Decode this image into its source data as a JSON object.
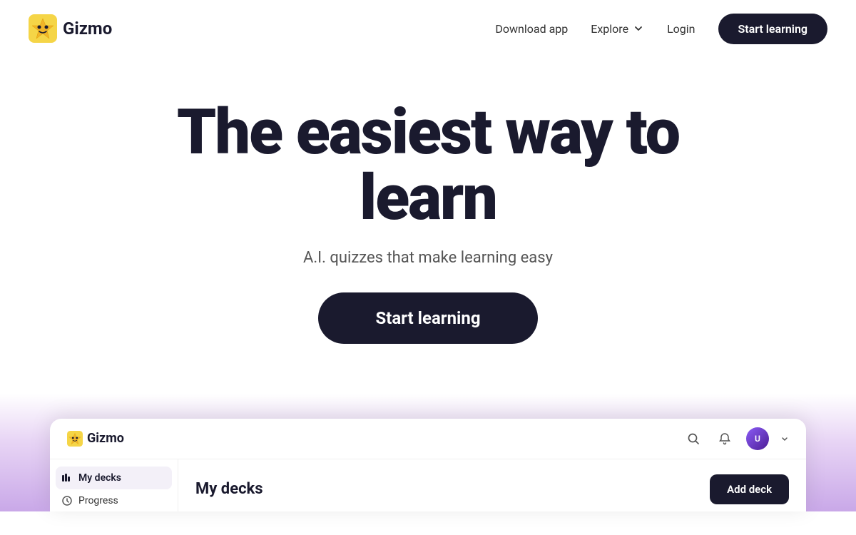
{
  "navbar": {
    "logo_text": "Gizmo",
    "nav_download": "Download app",
    "nav_explore": "Explore",
    "nav_login": "Login",
    "nav_start_learning": "Start learning"
  },
  "hero": {
    "title": "The easiest way to learn",
    "subtitle": "A.I. quizzes that make learning easy",
    "cta_button": "Start learning"
  },
  "app_preview": {
    "logo_text": "Gizmo",
    "my_decks_label": "My decks",
    "progress_label": "Progress",
    "page_title": "My decks",
    "add_deck_label": "Add deck"
  }
}
